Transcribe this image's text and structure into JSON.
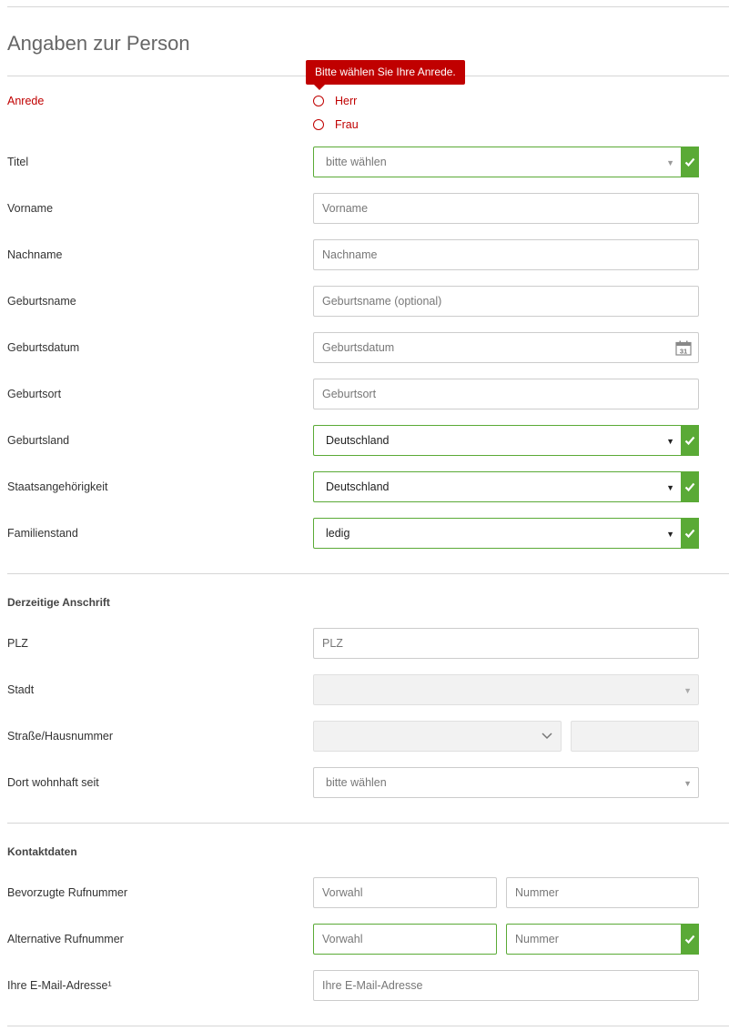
{
  "section": {
    "title": "Angaben zur Person"
  },
  "anrede": {
    "label": "Anrede",
    "tooltip": "Bitte wählen Sie Ihre Anrede.",
    "options": [
      "Herr",
      "Frau"
    ]
  },
  "titel": {
    "label": "Titel",
    "value": "bitte wählen"
  },
  "vorname": {
    "label": "Vorname",
    "placeholder": "Vorname"
  },
  "nachname": {
    "label": "Nachname",
    "placeholder": "Nachname"
  },
  "geburtsname": {
    "label": "Geburtsname",
    "placeholder": "Geburtsname (optional)"
  },
  "geburtsdatum": {
    "label": "Geburtsdatum",
    "placeholder": "Geburtsdatum",
    "calendar_day": "31"
  },
  "geburtsort": {
    "label": "Geburtsort",
    "placeholder": "Geburtsort"
  },
  "geburtsland": {
    "label": "Geburtsland",
    "value": "Deutschland"
  },
  "staatsangehoerigkeit": {
    "label": "Staatsangehörigkeit",
    "value": "Deutschland"
  },
  "familienstand": {
    "label": "Familienstand",
    "value": "ledig"
  },
  "anschrift": {
    "title": "Derzeitige Anschrift",
    "plz": {
      "label": "PLZ",
      "placeholder": "PLZ"
    },
    "stadt": {
      "label": "Stadt",
      "value": ""
    },
    "strasse": {
      "label": "Straße/Hausnummer",
      "value": ""
    },
    "wohnhaft": {
      "label": "Dort wohnhaft seit",
      "value": "bitte wählen"
    }
  },
  "kontakt": {
    "title": "Kontaktdaten",
    "bevorzugt": {
      "label": "Bevorzugte Rufnummer",
      "vorwahl": "Vorwahl",
      "nummer": "Nummer"
    },
    "alternativ": {
      "label": "Alternative Rufnummer",
      "vorwahl": "Vorwahl",
      "nummer": "Nummer"
    },
    "email": {
      "label": "Ihre E-Mail-Adresse¹",
      "placeholder": "Ihre E-Mail-Adresse"
    }
  },
  "colors": {
    "error": "#c00000",
    "valid": "#5aaa36",
    "border": "#cccccc"
  },
  "icons": {
    "valid": "checkmark-icon",
    "date": "calendar-icon",
    "select": "caret-down-icon"
  }
}
